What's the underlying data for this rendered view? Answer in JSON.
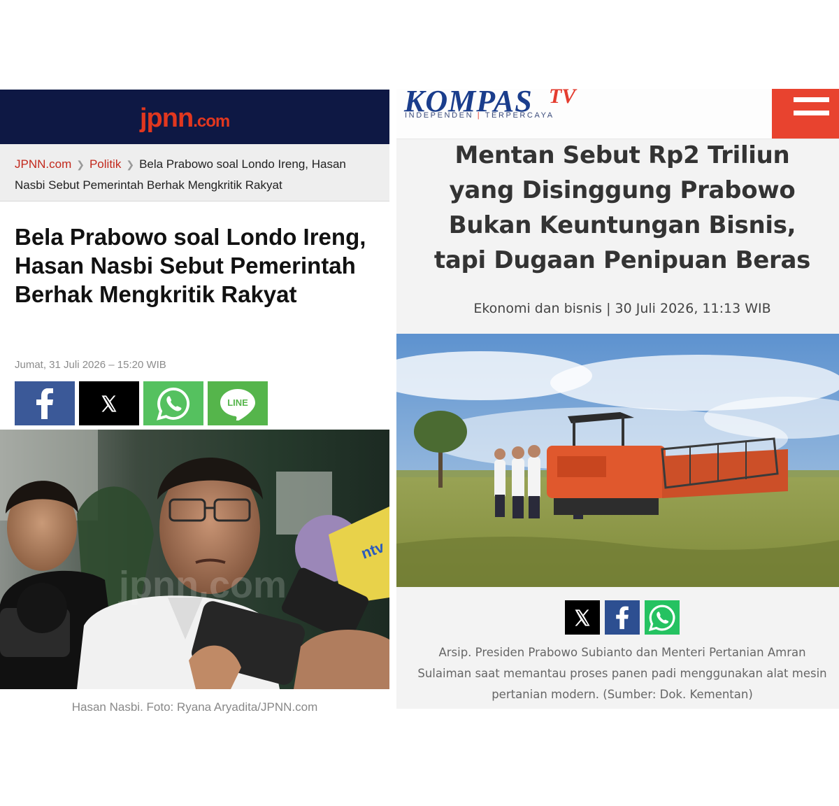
{
  "jpnn": {
    "logo_main": "jpnn",
    "logo_domain": ".com",
    "breadcrumb": {
      "home": "JPNN.com",
      "section": "Politik",
      "current": "Bela Prabowo soal Londo Ireng, Hasan Nasbi Sebut Pemerintah Berhak Mengkritik Rakyat"
    },
    "headline": "Bela Prabowo soal Londo Ireng, Hasan Nasbi Sebut Pemerintah Berhak Mengkritik Rakyat",
    "date": "Jumat, 31 Juli 2026 – 15:20 WIB",
    "share_buttons": [
      {
        "name": "facebook",
        "icon": "facebook-icon",
        "color": "#3b5998"
      },
      {
        "name": "x",
        "icon": "x-icon",
        "color": "#000000"
      },
      {
        "name": "whatsapp",
        "icon": "whatsapp-icon",
        "color": "#55c15f"
      },
      {
        "name": "line",
        "icon": "line-icon",
        "label": "LINE",
        "color": "#55b54b"
      }
    ],
    "photo_watermark": "jpnn.com",
    "photo_mic_label": "ntv",
    "photo_caption": "Hasan Nasbi. Foto: Ryana Aryadita/JPNN.com"
  },
  "kompas": {
    "brand": "KOMPAS",
    "brand_suffix": "TV",
    "tagline_left": "INDEPENDEN",
    "tagline_right": "TERPERCAYA",
    "menu_color": "#e8432f",
    "headline": "Mentan Sebut Rp2 Triliun yang Disinggung Prabowo Bukan Keuntungan Bisnis, tapi Dugaan Penipuan Beras",
    "category": "Ekonomi dan bisnis",
    "date": "30 Juli 2026, 11:13 WIB",
    "share_buttons": [
      {
        "name": "x",
        "icon": "x-icon",
        "color": "#000000"
      },
      {
        "name": "facebook",
        "icon": "facebook-icon",
        "color": "#2d4f91"
      },
      {
        "name": "whatsapp",
        "icon": "whatsapp-icon",
        "color": "#25c261"
      }
    ],
    "photo_caption": "Arsip. Presiden Prabowo Subianto dan Menteri Pertanian Amran Sulaiman saat memantau proses panen padi menggunakan alat mesin pertanian modern. (Sumber: Dok. Kementan)"
  }
}
